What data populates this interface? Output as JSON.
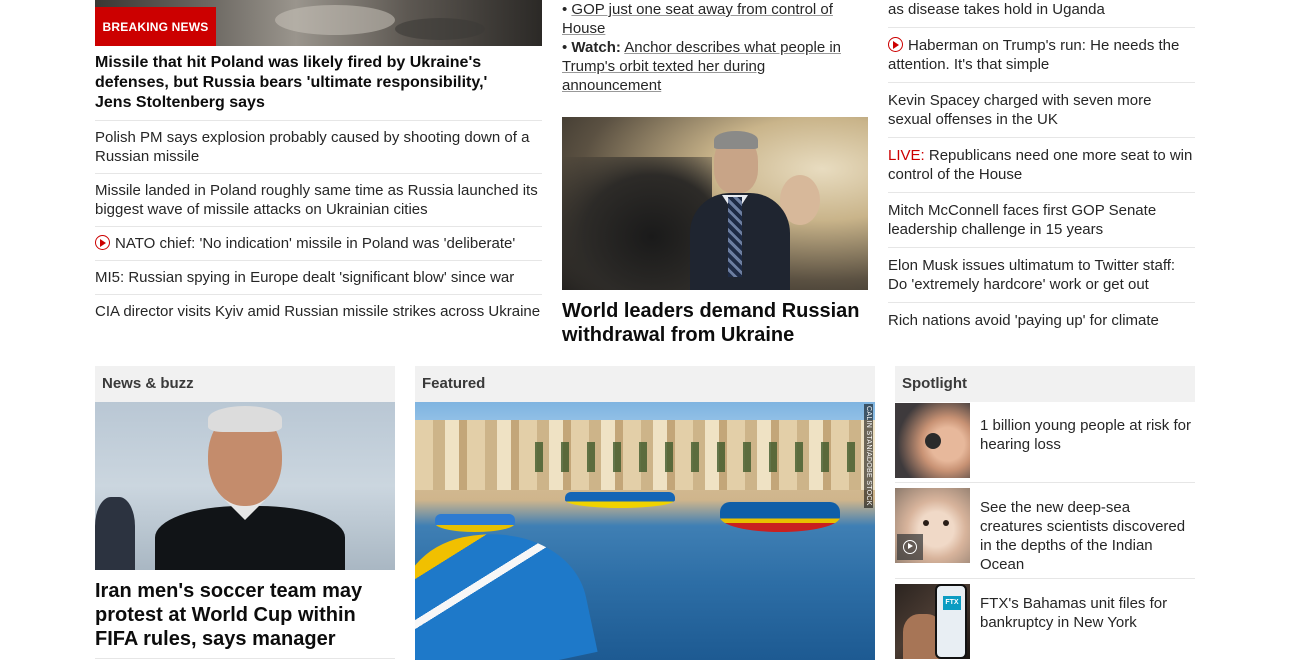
{
  "top_left": {
    "badge": "BREAKING NEWS",
    "headline": "Missile that hit Poland was likely fired by Ukraine's defenses, but Russia bears 'ultimate responsibility,' Jens Stoltenberg says",
    "links": [
      "Polish PM says explosion probably caused by shooting down of a Russian missile",
      "Missile landed in Poland roughly same time as Russia launched its biggest wave of missile attacks on Ukrainian cities",
      "NATO chief: 'No indication' missile in Poland was 'deliberate'",
      "MI5: Russian spying in Europe dealt 'significant blow' since war",
      "CIA director visits Kyiv amid Russian missile strikes across Ukraine"
    ]
  },
  "top_middle": {
    "bullet1": "GOP just one seat away from control of House",
    "bullet2_prefix": "Watch:",
    "bullet2_text": "Anchor describes what people in Trump's orbit texted her during announcement",
    "headline": "World leaders demand Russian withdrawal from Ukraine"
  },
  "top_right": {
    "links": [
      "US makes plans for possible Ebola outbreak as disease takes hold in Uganda",
      "Haberman on Trump's run: He needs the attention. It's that simple",
      "Kevin Spacey charged with seven more sexual offenses in the UK",
      "Republicans need one more seat to win control of the House",
      "Mitch McConnell faces first GOP Senate leadership challenge in 15 years",
      "Elon Musk issues ultimatum to Twitter staff: Do 'extremely hardcore' work or get out",
      "Rich nations avoid 'paying up' for climate"
    ],
    "live_label": "LIVE:"
  },
  "news_buzz": {
    "title": "News & buzz",
    "headline": "Iran men's soccer team may protest at World Cup within FIFA rules, says manager"
  },
  "featured": {
    "title": "Featured",
    "credit": "CALIN STAN/ADOBE STOCK"
  },
  "spotlight": {
    "title": "Spotlight",
    "items": [
      "1 billion young people at risk for hearing loss",
      "See the new deep-sea creatures scientists discovered in the depths of the Indian Ocean",
      "FTX's Bahamas unit files for bankruptcy in New York"
    ],
    "ftx_logo": "FTX"
  },
  "colors": {
    "accent": "#cc0000",
    "section_bg": "#f1f1f1",
    "divider": "#e6e6e6"
  },
  "icons": [
    "play-circle-icon",
    "video-play-icon"
  ]
}
